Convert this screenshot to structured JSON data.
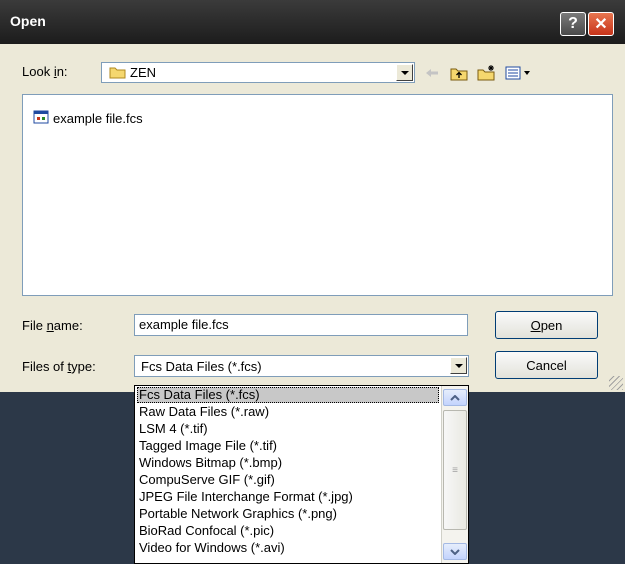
{
  "window": {
    "title": "Open",
    "help_glyph": "?",
    "close_glyph": "✕"
  },
  "lookin": {
    "label_pre": "Look ",
    "label_key": "i",
    "label_post": "n:",
    "value": "ZEN",
    "folder_icon": "folder-icon"
  },
  "toolbar": {
    "back_icon": "back-arrow-icon",
    "up_icon": "up-folder-icon",
    "new_icon": "new-folder-icon",
    "views_icon": "views-menu-icon"
  },
  "files": [
    {
      "name": "example file.fcs",
      "icon": "fcs-file-icon"
    }
  ],
  "filename": {
    "label_pre": "File ",
    "label_key": "n",
    "label_post": "ame:",
    "value": "example file.fcs"
  },
  "filetype": {
    "label_pre": "Files of ",
    "label_key": "t",
    "label_post": "ype:",
    "value": "Fcs Data Files (*.fcs)"
  },
  "buttons": {
    "open_key": "O",
    "open_rest": "pen",
    "cancel": "Cancel"
  },
  "type_options": [
    "Fcs Data Files (*.fcs)",
    "Raw Data Files (*.raw)",
    "LSM 4 (*.tif)",
    "Tagged Image File (*.tif)",
    "Windows Bitmap (*.bmp)",
    "CompuServe GIF (*.gif)",
    "JPEG File Interchange Format (*.jpg)",
    "Portable Network Graphics (*.png)",
    "BioRad Confocal (*.pic)",
    "Video for Windows (*.avi)"
  ],
  "colors": {
    "accent": "#c7341a",
    "selection": "#c8c8c8",
    "dialog_bg": "#ece9d8"
  }
}
